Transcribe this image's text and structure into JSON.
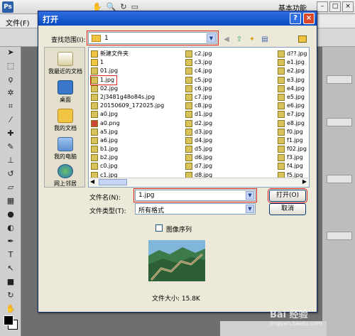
{
  "photoshop": {
    "logo": "Ps",
    "workspace_label": "基本功能",
    "menu_first": "文件(F)",
    "window_buttons": [
      "–",
      "□",
      "×"
    ]
  },
  "dialog": {
    "title": "打开",
    "help_btn": "?",
    "close_btn": "×",
    "lookin_label": "查找范围(I):",
    "lookin_value": "1",
    "places": [
      "我最近的文档",
      "桌面",
      "我的文档",
      "我的电脑",
      "网上邻居"
    ],
    "files_col1": [
      "新建文件夹",
      "1",
      "01.jpg",
      "1.jpg",
      "02.jpg",
      "2j3481g48o84s.jpg",
      "20150609_172025.jpg",
      "a0.jpg",
      "a0.png",
      "a5.jpg",
      "a6.jpg",
      "b1.jpg",
      "b2.jpg",
      "c0.jpg",
      "c1.jpg"
    ],
    "files_col2": [
      "c2.jpg",
      "c3.jpg",
      "c4.jpg",
      "c5.jpg",
      "c6.jpg",
      "c7.jpg",
      "c8.jpg",
      "d1.jpg",
      "d2.jpg",
      "d3.jpg",
      "d4.jpg",
      "d5.jpg",
      "d6.jpg",
      "d7.jpg",
      "d8.jpg"
    ],
    "files_col3": [
      "d??.jpg",
      "e1.jpg",
      "e2.jpg",
      "e3.jpg",
      "e4.jpg",
      "e5.jpg",
      "e6.jpg",
      "e7.jpg",
      "e8.jpg",
      "f0.jpg",
      "f1.jpg",
      "f02.jpg",
      "f3.jpg",
      "f4.jpg",
      "f5.jpg"
    ],
    "filename_label": "文件名(N):",
    "filename_value": "1.jpg",
    "filetype_label": "文件类型(T):",
    "filetype_value": "所有格式",
    "open_button": "打开(O)",
    "cancel_button": "取消",
    "image_sequence_label": "图像序列",
    "file_size": "文件大小: 15.8K"
  },
  "watermark": {
    "text": "Bai 经验",
    "sub": "jingyan.baidu.com"
  }
}
